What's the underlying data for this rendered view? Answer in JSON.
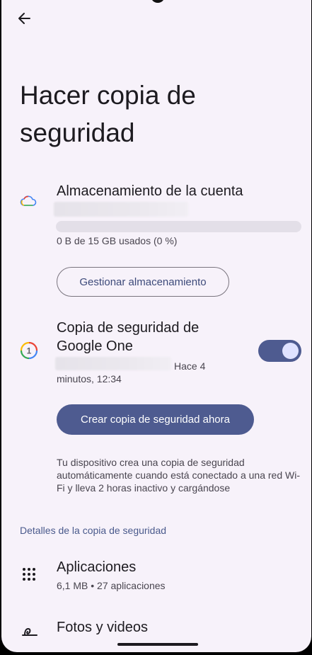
{
  "header": {
    "title": "Hacer copia de seguridad"
  },
  "storage": {
    "label": "Almacenamiento de la cuenta",
    "usage": "0 B de 15 GB usados (0 %)",
    "usage_fraction": 0.0,
    "manage_button": "Gestionar almacenamiento"
  },
  "backup": {
    "label": "Copia de seguridad de Google One",
    "last_backup": "Hace 4 minutos, 12:34",
    "toggle_on": true,
    "backup_now_button": "Crear copia de seguridad ahora",
    "info": "Tu dispositivo crea una copia de seguridad automáticamente cuando está conectado a una red Wi-Fi y lleva 2 horas inactivo y cargándose"
  },
  "details": {
    "header": "Detalles de la copia de seguridad",
    "items": [
      {
        "title": "Aplicaciones",
        "subtitle": "6,1 MB • 27 aplicaciones",
        "icon": "apps-grid-icon"
      },
      {
        "title": "Fotos y videos",
        "subtitle": "",
        "icon": "photos-icon"
      }
    ]
  },
  "colors": {
    "background": "#f7f2fa",
    "accent": "#4e5b90",
    "text_primary": "#1d1b20",
    "text_secondary": "#49454f"
  }
}
